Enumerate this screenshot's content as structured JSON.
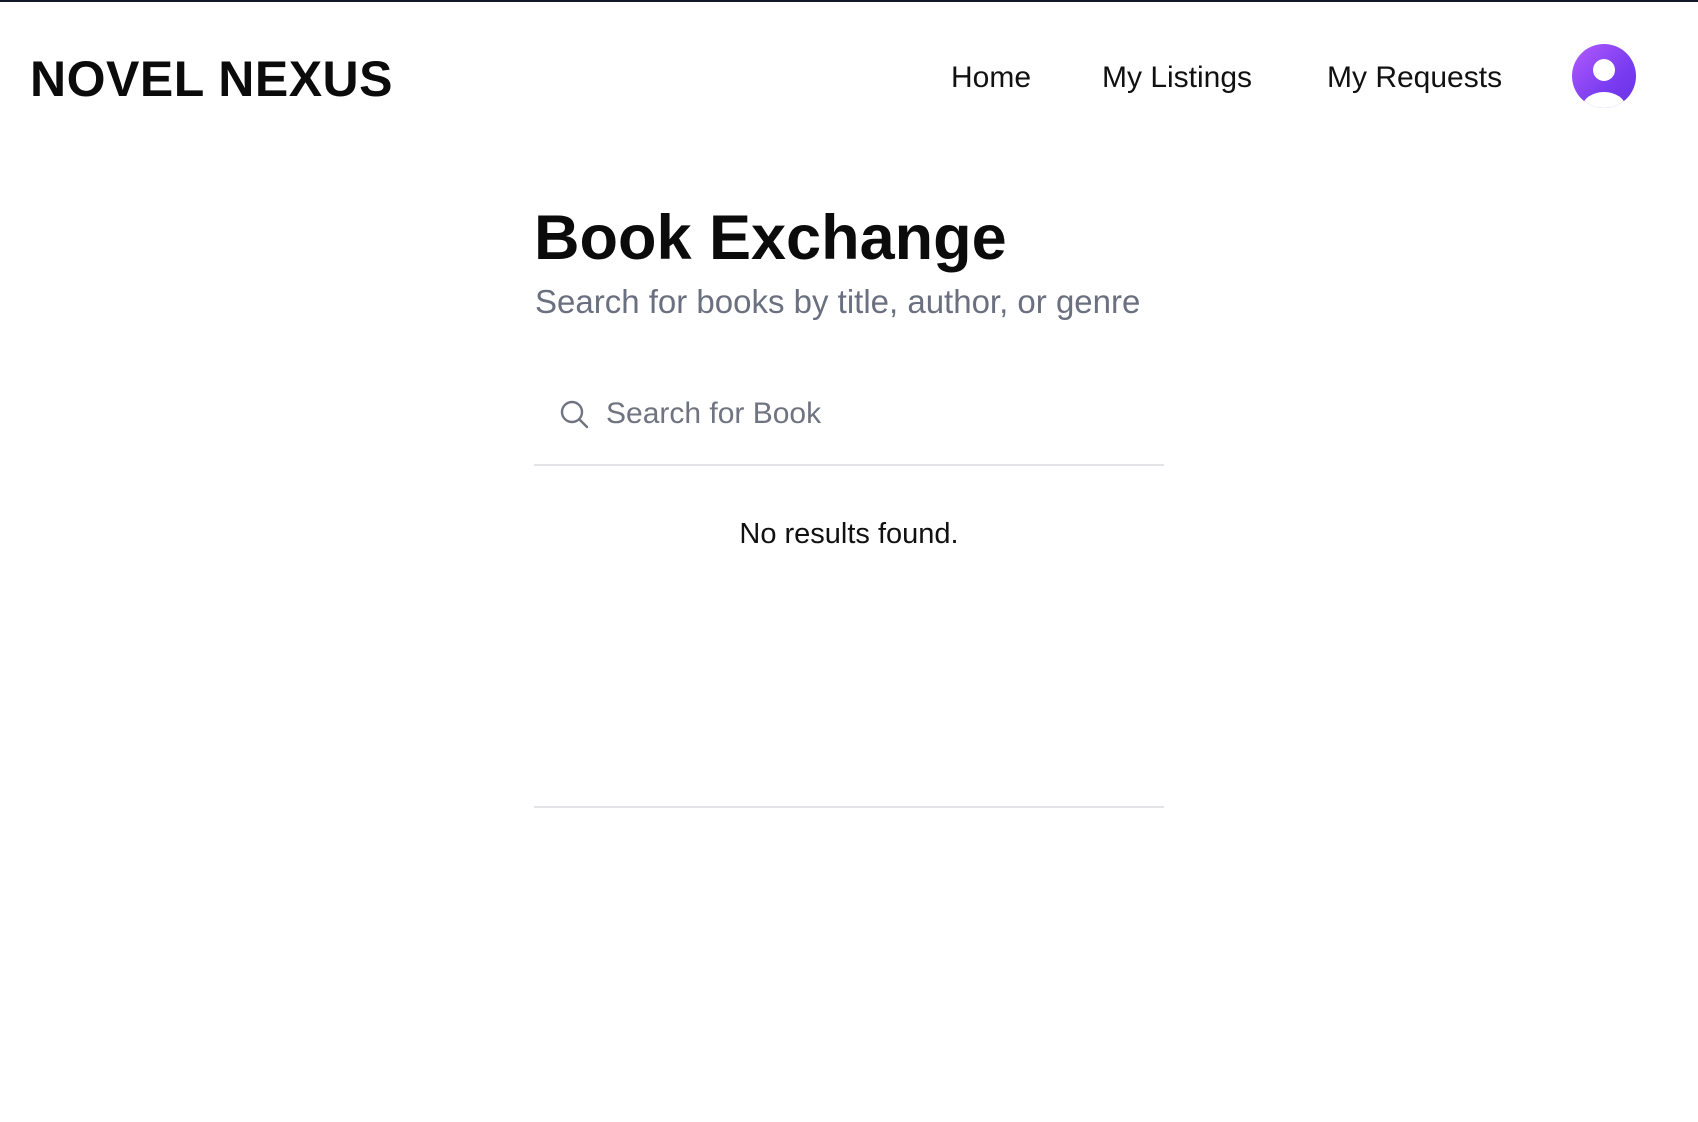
{
  "header": {
    "brand": "NOVEL NEXUS",
    "nav": [
      {
        "label": "Home"
      },
      {
        "label": "My Listings"
      },
      {
        "label": "My Requests"
      }
    ],
    "avatar_icon": "user-avatar-icon"
  },
  "main": {
    "title": "Book Exchange",
    "subtitle": "Search for books by title, author, or genre",
    "search": {
      "placeholder": "Search for Book",
      "value": "",
      "icon": "search-icon"
    },
    "results": {
      "empty_message": "No results found."
    }
  },
  "colors": {
    "accent_gradient_start": "#b35bff",
    "accent_gradient_end": "#6a2fe6",
    "subtitle_text": "#6b7080",
    "divider": "#e3e4e8"
  }
}
